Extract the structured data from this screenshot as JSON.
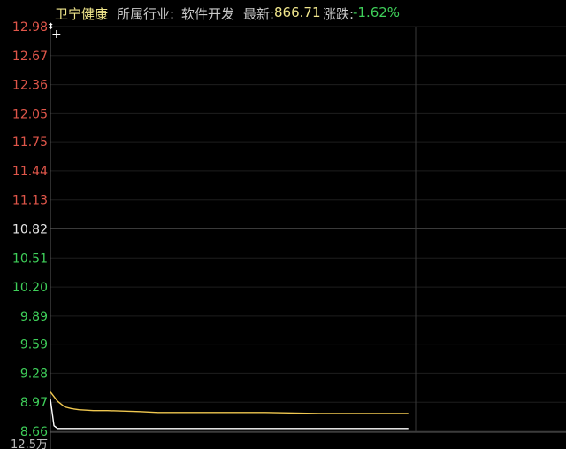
{
  "header": {
    "stock_name": "卫宁健康",
    "industry_label": "所属行业:",
    "industry_value": "软件开发",
    "last_label": "最新:",
    "last_value": "866.71",
    "change_label": "涨跌:",
    "change_value": "-1.62%"
  },
  "colors": {
    "up": "#e0564a",
    "down": "#3fd05a",
    "neutral": "#e6e6e6",
    "price_line": "#ffffff",
    "avg_line": "#f0c850",
    "grid": "#1e1e1e",
    "axis": "#5a5a5a"
  },
  "chart_data": {
    "type": "line",
    "y_tick_labels": [
      "12.98",
      "12.67",
      "12.36",
      "12.05",
      "11.75",
      "11.44",
      "11.13",
      "10.82",
      "10.51",
      "10.20",
      "9.89",
      "9.59",
      "9.28",
      "8.97",
      "8.66"
    ],
    "ylim": [
      8.66,
      12.98
    ],
    "prev_close": 10.82,
    "bottom_label": "12.5万",
    "x_session_fraction_shown": 0.5,
    "series": [
      {
        "x": [
          0,
          0.01,
          0.02,
          0.04,
          0.06,
          0.1,
          0.15,
          0.25,
          0.5,
          0.75,
          1.0
        ],
        "values": [
          9.0,
          8.72,
          8.69,
          8.69,
          8.69,
          8.69,
          8.69,
          8.69,
          8.69,
          8.69,
          8.69
        ]
      },
      {
        "x": [
          0,
          0.02,
          0.04,
          0.06,
          0.08,
          0.12,
          0.16,
          0.25,
          0.3,
          0.5,
          0.6,
          0.75,
          1.0
        ],
        "values": [
          9.08,
          8.98,
          8.92,
          8.9,
          8.89,
          8.88,
          8.88,
          8.87,
          8.86,
          8.86,
          8.86,
          8.85,
          8.85
        ]
      }
    ]
  }
}
